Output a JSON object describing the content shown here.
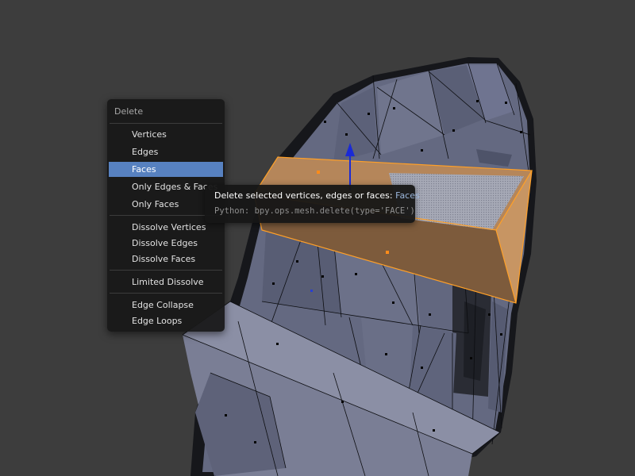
{
  "menu": {
    "title": "Delete",
    "items": [
      {
        "label": "Vertices",
        "active": false
      },
      {
        "label": "Edges",
        "active": false
      },
      {
        "label": "Faces",
        "active": true
      },
      {
        "label": "Only Edges & Faces",
        "active": false
      },
      {
        "label": "Only Faces",
        "active": false
      },
      {
        "label": "Dissolve Vertices",
        "active": false
      },
      {
        "label": "Dissolve Edges",
        "active": false
      },
      {
        "label": "Dissolve Faces",
        "active": false
      },
      {
        "label": "Limited Dissolve",
        "active": false
      },
      {
        "label": "Edge Collapse",
        "active": false
      },
      {
        "label": "Edge Loops",
        "active": false
      }
    ]
  },
  "tooltip": {
    "description": "Delete selected vertices, edges or faces:",
    "value": "Faces",
    "python": "Python: bpy.ops.mesh.delete(type='FACE')"
  },
  "colors": {
    "background": "#3d3d3d",
    "mesh_face": "#6b7088",
    "selection_face": "#b08050",
    "selection_edge": "#ffa028",
    "menu_highlight": "#5781c0",
    "tooltip_value": "#9cb7dc"
  },
  "icons": {
    "gizmo": "transform-arrow-z-icon"
  }
}
